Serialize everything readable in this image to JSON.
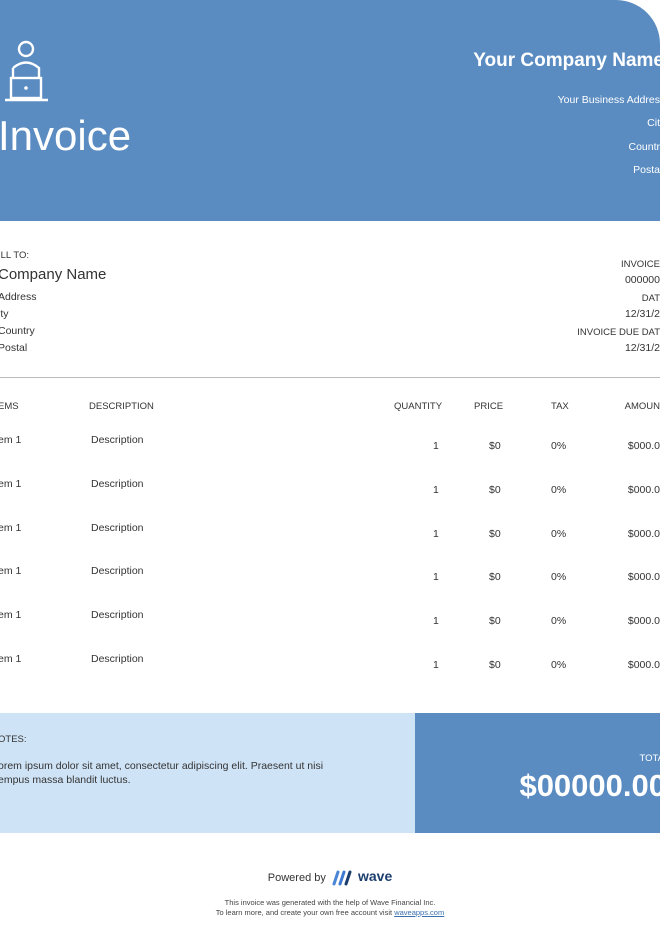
{
  "header": {
    "title": "Invoice",
    "company_name": "Your Company Name",
    "address_lines": [
      "Your Business Addres",
      "Cit",
      "Countr",
      "Posta"
    ],
    "accent_color": "#5a8cc2",
    "logo_icon": "person-at-laptop-icon"
  },
  "bill_to": {
    "label": "ILL TO:",
    "name": "Company Name",
    "lines": [
      "Address",
      "ity",
      "Country",
      "Postal"
    ]
  },
  "meta": {
    "invoice_label": "INVOICE",
    "invoice_number": "000000",
    "date_label": "DAT",
    "date": "12/31/2",
    "due_label": "INVOICE DUE DAT",
    "due_date": "12/31/2"
  },
  "table": {
    "headers": {
      "items": "EMS",
      "description": "DESCRIPTION",
      "quantity": "QUANTITY",
      "price": "PRICE",
      "tax": "TAX",
      "amount": "AMOUN"
    },
    "rows": [
      {
        "item": "em 1",
        "description": "Description",
        "quantity": "1",
        "price": "$0",
        "tax": "0%",
        "amount": "$000.0"
      },
      {
        "item": "em 1",
        "description": "Description",
        "quantity": "1",
        "price": "$0",
        "tax": "0%",
        "amount": "$000.0"
      },
      {
        "item": "em 1",
        "description": "Description",
        "quantity": "1",
        "price": "$0",
        "tax": "0%",
        "amount": "$000.0"
      },
      {
        "item": "em 1",
        "description": "Description",
        "quantity": "1",
        "price": "$0",
        "tax": "0%",
        "amount": "$000.0"
      },
      {
        "item": "em 1",
        "description": "Description",
        "quantity": "1",
        "price": "$0",
        "tax": "0%",
        "amount": "$000.0"
      },
      {
        "item": "em 1",
        "description": "Description",
        "quantity": "1",
        "price": "$0",
        "tax": "0%",
        "amount": "$000.0"
      }
    ]
  },
  "notes": {
    "label": "OTES:",
    "text": "orem ipsum dolor sit amet, consectetur adipiscing elit. Praesent ut nisi empus massa blandit luctus.",
    "background_color": "#cfe3f6"
  },
  "total": {
    "label": "TOTA",
    "amount": "$00000.00"
  },
  "footer": {
    "powered_by": "Powered by",
    "brand": "wave",
    "line1": "This invoice was generated with the help of Wave Financial Inc.",
    "line2_prefix": "To learn more, and create your own free account visit",
    "link": "waveapps.com"
  }
}
